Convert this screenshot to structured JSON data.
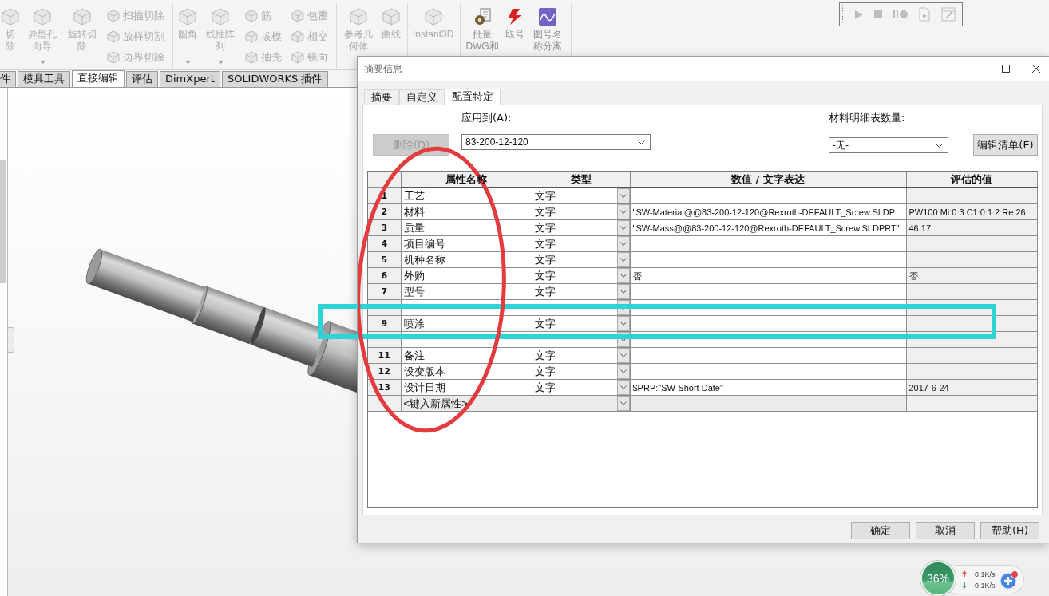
{
  "ribbon": {
    "groups": [
      {
        "items": [
          {
            "kind": "large",
            "label": "切除",
            "caret": false,
            "disabled": true
          },
          {
            "kind": "large",
            "label": "异型孔向导",
            "caret": true,
            "disabled": true
          },
          {
            "kind": "large",
            "label": "旋转切除",
            "caret": false,
            "disabled": true
          },
          {
            "kind": "stack",
            "entries": [
              {
                "label": "扫描切除",
                "disabled": true
              },
              {
                "label": "放样切割",
                "disabled": true
              },
              {
                "label": "边界切除",
                "disabled": true
              }
            ]
          }
        ]
      },
      {
        "items": [
          {
            "kind": "large",
            "label": "圆角",
            "caret": true,
            "disabled": true
          },
          {
            "kind": "large",
            "label": "线性阵列",
            "caret": true,
            "disabled": true
          },
          {
            "kind": "stack",
            "entries": [
              {
                "label": "筋",
                "disabled": true
              },
              {
                "label": "拔模",
                "disabled": true
              },
              {
                "label": "抽壳",
                "disabled": true
              }
            ]
          },
          {
            "kind": "stack",
            "entries": [
              {
                "label": "包覆",
                "disabled": true
              },
              {
                "label": "相交",
                "disabled": true
              },
              {
                "label": "镜向",
                "disabled": true
              }
            ]
          }
        ]
      },
      {
        "items": [
          {
            "kind": "large",
            "label": "参考几何体",
            "caret": false,
            "disabled": true
          },
          {
            "kind": "large",
            "label": "曲线",
            "caret": false,
            "disabled": true
          }
        ]
      },
      {
        "items": [
          {
            "kind": "large",
            "label": "Instant3D",
            "caret": false,
            "disabled": true
          }
        ]
      },
      {
        "items": [
          {
            "kind": "large",
            "label": "批量\nDWG和",
            "caret": false,
            "disabled": false
          },
          {
            "kind": "large",
            "label": "取号",
            "caret": false,
            "disabled": false
          },
          {
            "kind": "large",
            "label": "图号名称分离",
            "caret": false,
            "disabled": false
          }
        ]
      }
    ]
  },
  "command_tabs": [
    {
      "label": "件",
      "selected": false
    },
    {
      "label": "模具工具",
      "selected": false
    },
    {
      "label": "直接编辑",
      "selected": true
    },
    {
      "label": "评估",
      "selected": false
    },
    {
      "label": "DimXpert",
      "selected": false
    },
    {
      "label": "SOLIDWORKS 插件",
      "selected": false
    }
  ],
  "dialog": {
    "title": "摘要信息",
    "tabs": [
      {
        "label": "摘要",
        "selected": false
      },
      {
        "label": "自定义",
        "selected": false
      },
      {
        "label": "配置特定",
        "selected": true
      }
    ],
    "delete_button": {
      "label": "删除(D)",
      "disabled": true
    },
    "apply_to": {
      "label": "应用到(A):",
      "value": "83-200-12-120"
    },
    "bom_quantity": {
      "label": "材料明细表数量:",
      "value": "-无-"
    },
    "edit_list_button": {
      "label": "编辑清单(E)"
    },
    "table": {
      "columns": [
        "属性名称",
        "类型",
        "数值 / 文字表达",
        "评估的值"
      ],
      "rows": [
        {
          "kind": "property",
          "number": "1",
          "name": "工艺",
          "type": "文字"
        },
        {
          "kind": "property",
          "number": "2",
          "name": "材料",
          "type": "文字",
          "value": "\"SW-Material@@83-200-12-120@Rexroth-DEFAULT_Screw.SLDP",
          "evaluated": "PW100:Mi:0:3:C1:0:1:2:Re:26:"
        },
        {
          "kind": "property",
          "number": "3",
          "name": "质量",
          "type": "文字",
          "value": "\"SW-Mass@@83-200-12-120@Rexroth-DEFAULT_Screw.SLDPRT\"",
          "evaluated": "46.17"
        },
        {
          "kind": "property",
          "number": "4",
          "name": "项目编号",
          "type": "文字"
        },
        {
          "kind": "property",
          "number": "5",
          "name": "机种名称",
          "type": "文字"
        },
        {
          "kind": "property",
          "number": "6",
          "name": "外购",
          "type": "文字",
          "value": "否",
          "evaluated": "否"
        },
        {
          "kind": "property",
          "number": "7",
          "name": "型号",
          "type": "文字"
        },
        {
          "kind": "property"
        },
        {
          "kind": "property",
          "number": "9",
          "name": "喷涂",
          "type": "文字"
        },
        {
          "kind": "property"
        },
        {
          "kind": "property",
          "number": "11",
          "name": "备注",
          "type": "文字"
        },
        {
          "kind": "property",
          "number": "12",
          "name": "设变版本",
          "type": "文字"
        },
        {
          "kind": "property",
          "number": "13",
          "name": "设计日期",
          "type": "文字",
          "value": "$PRP:\"SW-Short Date\"",
          "evaluated": "2017-6-24"
        },
        {
          "kind": "new",
          "name": "<键入新属性>"
        }
      ]
    },
    "buttons": [
      {
        "label": "确定"
      },
      {
        "label": "取消"
      },
      {
        "label": "帮助(H)"
      }
    ]
  },
  "net_widget": {
    "percent": "36%",
    "upload": "0.1K/s",
    "download": "0.1K/s"
  }
}
